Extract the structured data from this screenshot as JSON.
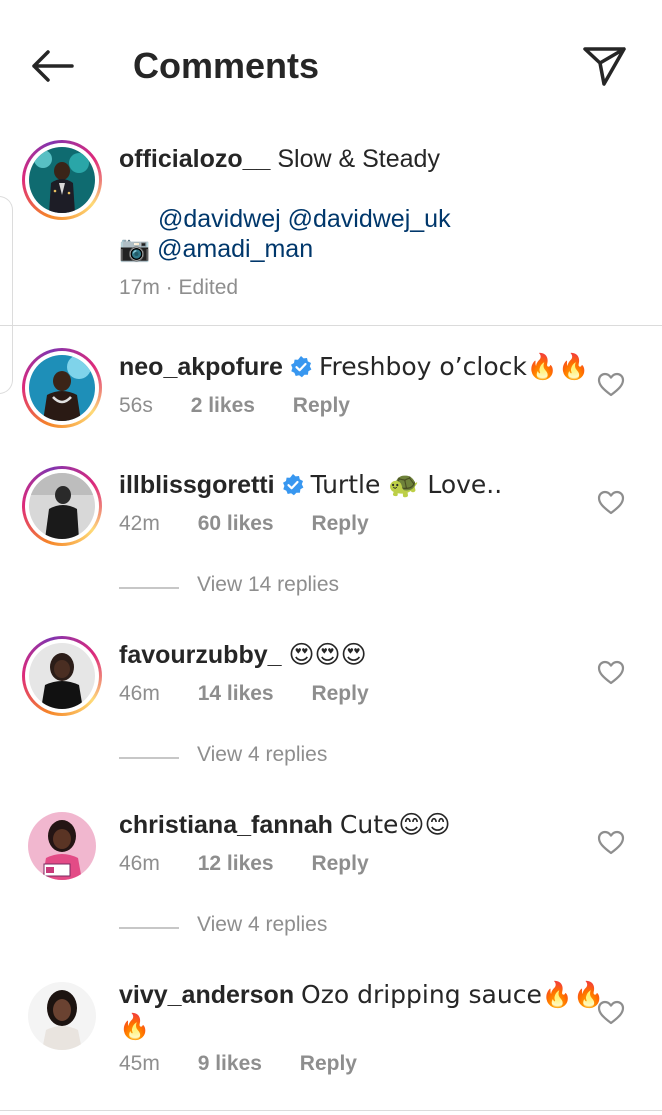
{
  "header": {
    "title": "Comments",
    "back_icon": "arrow-left-icon",
    "send_icon": "paper-plane-icon"
  },
  "caption": {
    "username": "officialozo__",
    "text": "Slow & Steady",
    "mentions_line1": "@davidwej @davidwej_uk",
    "camera_emoji": "📷",
    "mentions_line2": "@amadi_man",
    "time": "17m",
    "edited": "Edited",
    "meta": "17m · Edited"
  },
  "comments": [
    {
      "username": "neo_akpofure",
      "verified": true,
      "text": "Freshboy o’clock🔥🔥",
      "time": "56s",
      "likes": "2 likes",
      "reply": "Reply"
    },
    {
      "username": "illblissgoretti",
      "verified": true,
      "text": "Turtle 🐢 Love..",
      "time": "42m",
      "likes": "60 likes",
      "reply": "Reply",
      "view_replies": "View 14 replies"
    },
    {
      "username": "favourzubby_",
      "verified": false,
      "text": "😍😍😍",
      "time": "46m",
      "likes": "14 likes",
      "reply": "Reply",
      "view_replies": "View 4 replies"
    },
    {
      "username": "christiana_fannah",
      "verified": false,
      "text": "Cute😊😊",
      "time": "46m",
      "likes": "12 likes",
      "reply": "Reply",
      "view_replies": "View 4 replies"
    },
    {
      "username": "vivy_anderson",
      "verified": false,
      "text": "Ozo dripping sauce🔥🔥",
      "text_wrap": "🔥",
      "time": "45m",
      "likes": "9 likes",
      "reply": "Reply"
    }
  ],
  "colors": {
    "link": "#00376b",
    "verified": "#3897f0",
    "meta": "#8e8e8e",
    "text": "#262626"
  }
}
